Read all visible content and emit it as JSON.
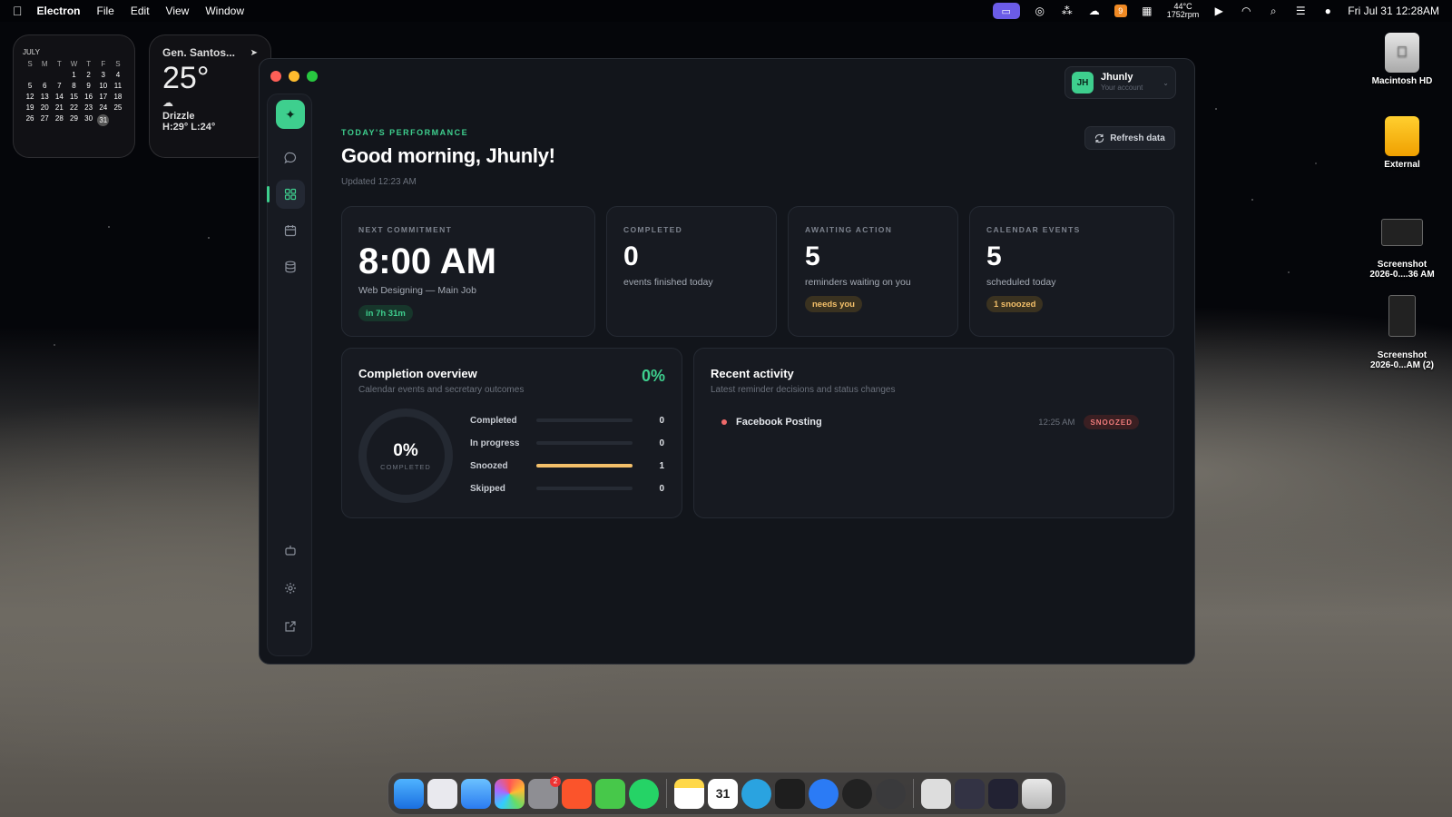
{
  "menubar": {
    "app_name": "Electron",
    "menus": [
      "File",
      "Edit",
      "View",
      "Window"
    ],
    "weather_temp": "44°C",
    "weather_time": "1752rpm",
    "badge_count": "9",
    "datetime": "Fri Jul 31  12:28AM"
  },
  "calendar_widget": {
    "month": "JULY",
    "day_headers": [
      "S",
      "M",
      "T",
      "W",
      "T",
      "F",
      "S"
    ],
    "days": [
      "",
      "",
      "",
      "1",
      "2",
      "3",
      "4",
      "5",
      "6",
      "7",
      "8",
      "9",
      "10",
      "11",
      "12",
      "13",
      "14",
      "15",
      "16",
      "17",
      "18",
      "19",
      "20",
      "21",
      "22",
      "23",
      "24",
      "25",
      "26",
      "27",
      "28",
      "29",
      "30",
      "31"
    ],
    "today": "31"
  },
  "weather_widget": {
    "city": "Gen. Santos...",
    "temp": "25°",
    "condition": "Drizzle",
    "high_low": "H:29° L:24°"
  },
  "desktop_icons": [
    {
      "label": "Macintosh HD"
    },
    {
      "label": "External"
    },
    {
      "label": "Screenshot\n2026-0....36 AM"
    },
    {
      "label": "Screenshot\n2026-0...AM (2)"
    }
  ],
  "account": {
    "initials": "JH",
    "name": "Jhunly",
    "subtitle": "Your account"
  },
  "header": {
    "eyebrow": "TODAY'S PERFORMANCE",
    "greeting": "Good morning, Jhunly!",
    "updated": "Updated 12:23 AM",
    "refresh_label": "Refresh data"
  },
  "stats": {
    "next": {
      "label": "NEXT COMMITMENT",
      "value": "8:00 AM",
      "sub": "Web Designing — Main Job",
      "pill": "in 7h 31m"
    },
    "completed": {
      "label": "COMPLETED",
      "value": "0",
      "sub": "events finished today"
    },
    "awaiting": {
      "label": "AWAITING ACTION",
      "value": "5",
      "sub": "reminders waiting on you",
      "pill": "needs you"
    },
    "calendar": {
      "label": "CALENDAR EVENTS",
      "value": "5",
      "sub": "scheduled today",
      "pill": "1 snoozed"
    }
  },
  "completion": {
    "title": "Completion overview",
    "subtitle": "Calendar events and secretary outcomes",
    "percent": "0%",
    "ring_value": "0%",
    "ring_label": "COMPLETED",
    "rows": [
      {
        "label": "Completed",
        "value": "0",
        "fraction": 0
      },
      {
        "label": "In progress",
        "value": "0",
        "fraction": 0
      },
      {
        "label": "Snoozed",
        "value": "1",
        "fraction": 1
      },
      {
        "label": "Skipped",
        "value": "0",
        "fraction": 0
      }
    ]
  },
  "activity": {
    "title": "Recent activity",
    "subtitle": "Latest reminder decisions and status changes",
    "items": [
      {
        "title": "Facebook Posting",
        "time": "12:25 AM",
        "status": "SNOOZED"
      }
    ]
  },
  "dock": {
    "calendar_day": "31",
    "settings_badge": "2"
  },
  "colors": {
    "accent": "#3ecf8e",
    "amber": "#f4c06a",
    "danger": "#ef6a6a"
  }
}
